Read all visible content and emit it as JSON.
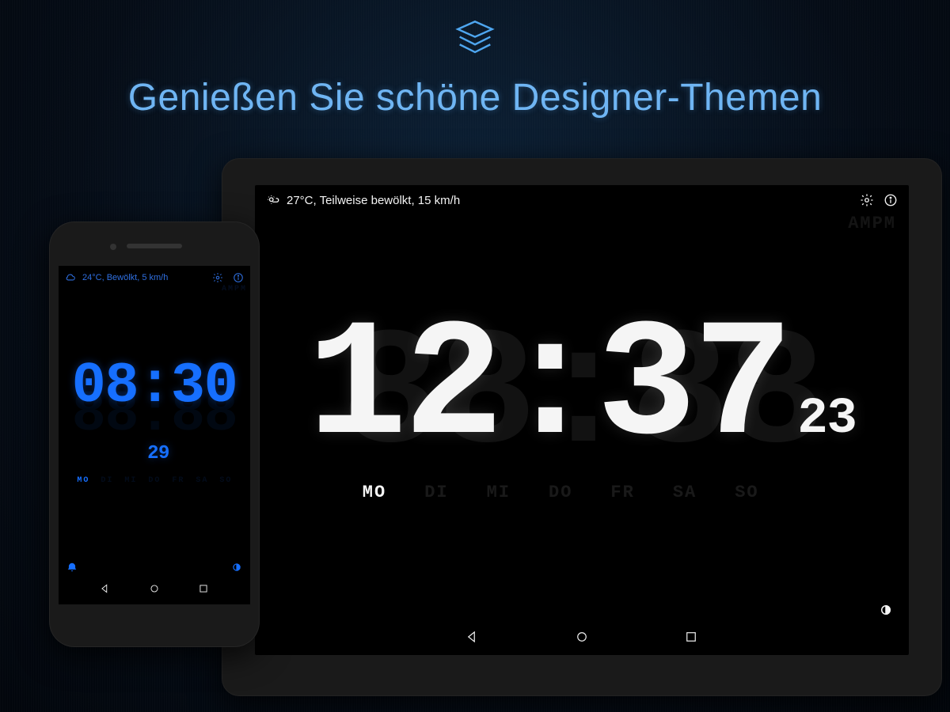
{
  "hero": {
    "icon": "layers-icon",
    "headline": "Genießen Sie schöne Designer-Themen"
  },
  "tablet": {
    "weather": "27°C, Teilweise bewölkt, 15 km/h",
    "time": "12:37",
    "seconds": "23",
    "ampm_ghost": "AMPM",
    "days": [
      "MO",
      "DI",
      "MI",
      "DO",
      "FR",
      "SA",
      "SO"
    ],
    "active_day_index": 0,
    "accent": "#f5f5f5"
  },
  "phone": {
    "weather": "24°C, Bewölkt, 5 km/h",
    "time": "08:30",
    "seconds": "29",
    "ampm_ghost": "AMPM",
    "days": [
      "MO",
      "DI",
      "MI",
      "DO",
      "FR",
      "SA",
      "SO"
    ],
    "active_day_index": 0,
    "accent": "#166fff"
  },
  "ghost_digits": "88:88"
}
